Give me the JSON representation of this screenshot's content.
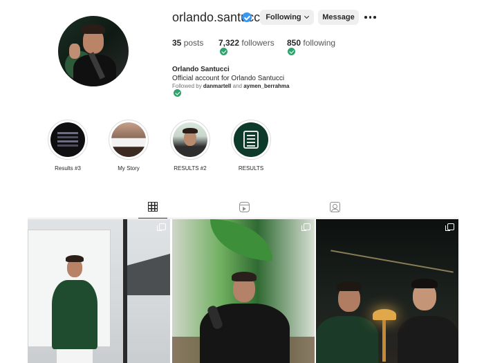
{
  "profile": {
    "username": "orlando.santucci",
    "verified": true,
    "following_button": "Following",
    "message_button": "Message",
    "more_icon": "more-dots-icon",
    "stats": {
      "posts_count": "35",
      "posts_label": "posts",
      "followers_count": "7,322",
      "followers_label": "followers",
      "following_count": "850",
      "following_label": "following"
    },
    "full_name": "Orlando Santucci",
    "bio": "Official account for Orlando Santucci",
    "followed_by_prefix": "Followed by",
    "followed_by_user1": "danmartell",
    "followed_by_and": "and",
    "followed_by_user2": "aymen_berrahma"
  },
  "highlights": [
    {
      "label": "Results #3"
    },
    {
      "label": "My Story"
    },
    {
      "label": "RESULTS #2"
    },
    {
      "label": "RESULTS"
    }
  ],
  "tabs": [
    {
      "icon": "grid-icon",
      "active": true
    },
    {
      "icon": "reels-icon",
      "active": false
    },
    {
      "icon": "tagged-icon",
      "active": false
    }
  ],
  "colors": {
    "verified_badge": "#3897f0",
    "check_badge": "#2ea36e",
    "button_bg": "#efefef",
    "text": "#262626"
  }
}
